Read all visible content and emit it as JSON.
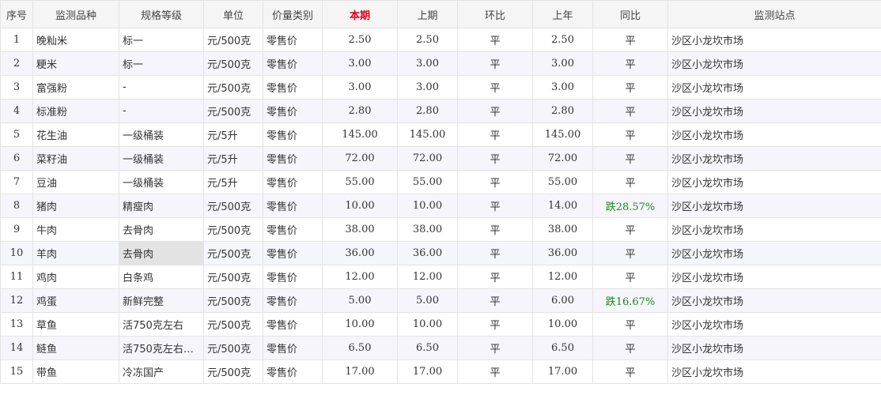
{
  "table": {
    "headers": [
      "序号",
      "监测品种",
      "规格等级",
      "单位",
      "价量类别",
      "本期",
      "上期",
      "环比",
      "上年",
      "同比",
      "监测站点"
    ],
    "rows": [
      [
        "1",
        "晚籼米",
        "标一",
        "元/500克",
        "零售价",
        "2.50",
        "2.50",
        "平",
        "2.50",
        "平",
        "沙区小龙坎市场"
      ],
      [
        "2",
        "粳米",
        "标一",
        "元/500克",
        "零售价",
        "3.00",
        "3.00",
        "平",
        "3.00",
        "平",
        "沙区小龙坎市场"
      ],
      [
        "3",
        "富强粉",
        "-",
        "元/500克",
        "零售价",
        "3.00",
        "3.00",
        "平",
        "3.00",
        "平",
        "沙区小龙坎市场"
      ],
      [
        "4",
        "标准粉",
        "-",
        "元/500克",
        "零售价",
        "2.80",
        "2.80",
        "平",
        "2.80",
        "平",
        "沙区小龙坎市场"
      ],
      [
        "5",
        "花生油",
        "一级桶装",
        "元/5升",
        "零售价",
        "145.00",
        "145.00",
        "平",
        "145.00",
        "平",
        "沙区小龙坎市场"
      ],
      [
        "6",
        "菜籽油",
        "一级桶装",
        "元/5升",
        "零售价",
        "72.00",
        "72.00",
        "平",
        "72.00",
        "平",
        "沙区小龙坎市场"
      ],
      [
        "7",
        "豆油",
        "一级桶装",
        "元/5升",
        "零售价",
        "55.00",
        "55.00",
        "平",
        "55.00",
        "平",
        "沙区小龙坎市场"
      ],
      [
        "8",
        "猪肉",
        "精瘦肉",
        "元/500克",
        "零售价",
        "10.00",
        "10.00",
        "平",
        "14.00",
        "跌28.57%",
        "沙区小龙坎市场"
      ],
      [
        "9",
        "牛肉",
        "去骨肉",
        "元/500克",
        "零售价",
        "38.00",
        "38.00",
        "平",
        "38.00",
        "平",
        "沙区小龙坎市场"
      ],
      [
        "10",
        "羊肉",
        "去骨肉",
        "元/500克",
        "零售价",
        "36.00",
        "36.00",
        "平",
        "36.00",
        "平",
        "沙区小龙坎市场"
      ],
      [
        "11",
        "鸡肉",
        "白条鸡",
        "元/500克",
        "零售价",
        "12.00",
        "12.00",
        "平",
        "12.00",
        "平",
        "沙区小龙坎市场"
      ],
      [
        "12",
        "鸡蛋",
        "新鲜完整",
        "元/500克",
        "零售价",
        "5.00",
        "5.00",
        "平",
        "6.00",
        "跌16.67%",
        "沙区小龙坎市场"
      ],
      [
        "13",
        "草鱼",
        "活750克左右",
        "元/500克",
        "零售价",
        "10.00",
        "10.00",
        "平",
        "10.00",
        "平",
        "沙区小龙坎市场"
      ],
      [
        "14",
        "鲢鱼",
        "活750克左右…",
        "元/500克",
        "零售价",
        "6.50",
        "6.50",
        "平",
        "6.50",
        "平",
        "沙区小龙坎市场"
      ],
      [
        "15",
        "带鱼",
        "冷冻国产",
        "元/500克",
        "零售价",
        "17.00",
        "17.00",
        "平",
        "17.00",
        "平",
        "沙区小龙坎市场"
      ]
    ]
  },
  "colors": {
    "current_header": "#e0001b",
    "drop_text": "#178a17",
    "header_bg": "#f5f5f5",
    "row_alt_bg": "#f7f5fc",
    "selected_cell_bg": "#e3e3e3"
  }
}
